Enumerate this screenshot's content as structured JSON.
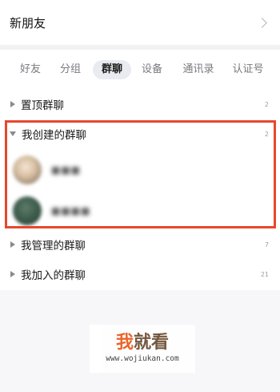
{
  "new_friends": {
    "label": "新朋友"
  },
  "tabs": [
    {
      "label": "好友"
    },
    {
      "label": "分组"
    },
    {
      "label": "群聊",
      "active": true
    },
    {
      "label": "设备"
    },
    {
      "label": "通讯录"
    },
    {
      "label": "认证号"
    }
  ],
  "groups": {
    "pinned": {
      "title": "置顶群聊",
      "count": "2"
    },
    "created": {
      "title": "我创建的群聊",
      "count": "2"
    },
    "managed": {
      "title": "我管理的群聊",
      "count": "7"
    },
    "joined": {
      "title": "我加入的群聊",
      "count": "21"
    }
  },
  "members": [
    {
      "name": "■■■"
    },
    {
      "name": "■■■■"
    }
  ],
  "watermark": {
    "text_a": "我",
    "text_b": "就看",
    "url": "www.wojiukan.com"
  },
  "colors": {
    "highlight": "#e8472c",
    "background": "#f2f2f5",
    "active_tab_bg": "#e8ebf0"
  }
}
